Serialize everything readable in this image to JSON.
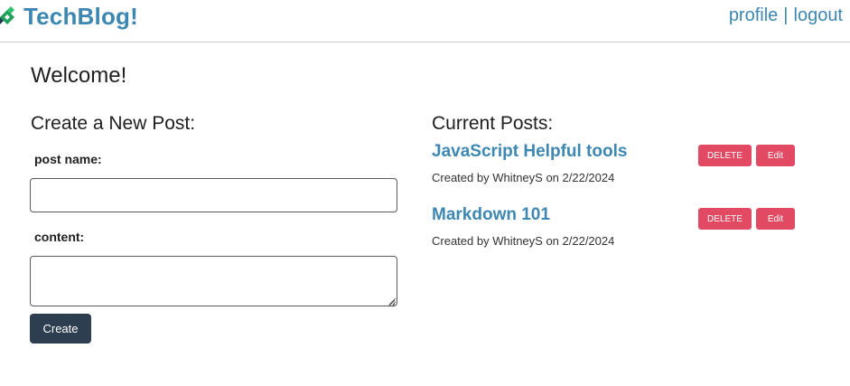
{
  "header": {
    "brand": "TechBlog!",
    "logo_icon": "pencil-icon",
    "nav": {
      "profile": "profile",
      "separator": "|",
      "logout": "logout"
    }
  },
  "main": {
    "welcome": "Welcome!",
    "new_post": {
      "heading": "Create a New Post:",
      "name_label": "post name:",
      "name_value": "",
      "content_label": "content:",
      "content_value": "",
      "submit_label": "Create"
    },
    "current_posts": {
      "heading": "Current Posts:",
      "posts": [
        {
          "title": "JavaScript Helpful tools",
          "meta": "Created by WhitneyS on 2/22/2024",
          "delete_label": "DELETE",
          "edit_label": "Edit"
        },
        {
          "title": "Markdown 101",
          "meta": "Created by WhitneyS on 2/22/2024",
          "delete_label": "DELETE",
          "edit_label": "Edit"
        }
      ]
    }
  },
  "colors": {
    "brand": "#3d87b3",
    "primary_button": "#2d3e50",
    "danger_button": "#e24a64",
    "logo_green": "#1fa05a",
    "logo_dark": "#1d3b4f"
  }
}
